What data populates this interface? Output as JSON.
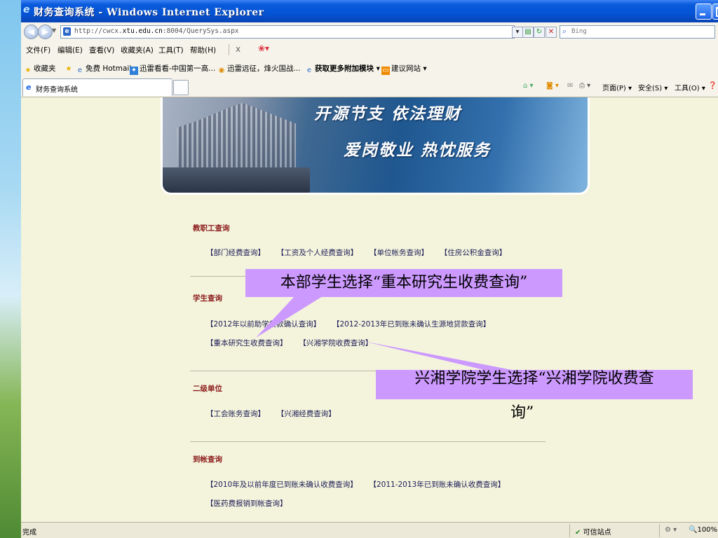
{
  "window": {
    "title": "财务查询系统 - Windows Internet Explorer",
    "ie_glyph": "e"
  },
  "address_bar": {
    "url_prefix": "http://cwcx.",
    "url_domain": "xtu.edu.cn",
    "url_suffix": ":8004/QuerySys.aspx",
    "search_placeholder": "Bing"
  },
  "menu": {
    "items": [
      "文件(F)",
      "编辑(E)",
      "查看(V)",
      "收藏夹(A)",
      "工具(T)",
      "帮助(H)"
    ],
    "close_glyph": "x"
  },
  "favorites_bar": {
    "favorites_label": "收藏夹",
    "items": [
      "免费 Hotmail",
      "迅雷看看-中国第一高...",
      "迅雷远征，烽火国战...",
      "获取更多附加模块 ▾",
      "建议网站 ▾"
    ]
  },
  "tabs": {
    "active_tab_label": "财务查询系统"
  },
  "command_bar": {
    "page_label": "页面(P) ▾",
    "safety_label": "安全(S) ▾",
    "tools_label": "工具(O) ▾"
  },
  "banner": {
    "slogan_line1": "开源节支  依法理财",
    "slogan_line2": "爱岗敬业  热忱服务"
  },
  "sections": {
    "staff": {
      "title": "教职工查询",
      "links": [
        "【部门经费查询】",
        "【工资及个人经费查询】",
        "【单位帐务查询】",
        "【住房公积金查询】"
      ]
    },
    "student": {
      "title": "学生查询",
      "row1": [
        "【2012年以前助学贷款确认查询】",
        "【2012-2013年已到账未确认生源地贷款查询】"
      ],
      "row2": [
        "【重本研究生收费查询】",
        "【兴湘学院收费查询】"
      ]
    },
    "secondary": {
      "title": "二级单位",
      "links": [
        "【工会账务查询】",
        "【兴湘经费查询】"
      ]
    },
    "arrival": {
      "title": "到帐查询",
      "row1": [
        "【2010年及以前年度已到账未确认收费查询】",
        "【2011-2013年已到账未确认收费查询】"
      ],
      "row2": [
        "【医药费报销到帐查询】"
      ]
    }
  },
  "callouts": {
    "callout1": "本部学生选择“重本研究生收费查询”",
    "callout2_line1": "兴湘学院学生选择“兴湘学院收费查",
    "callout2_line2": "询”",
    "color": "#cc99ff"
  },
  "status_bar": {
    "status_text": "完成",
    "zone_text": "可信站点",
    "zoom_text": "100%"
  }
}
